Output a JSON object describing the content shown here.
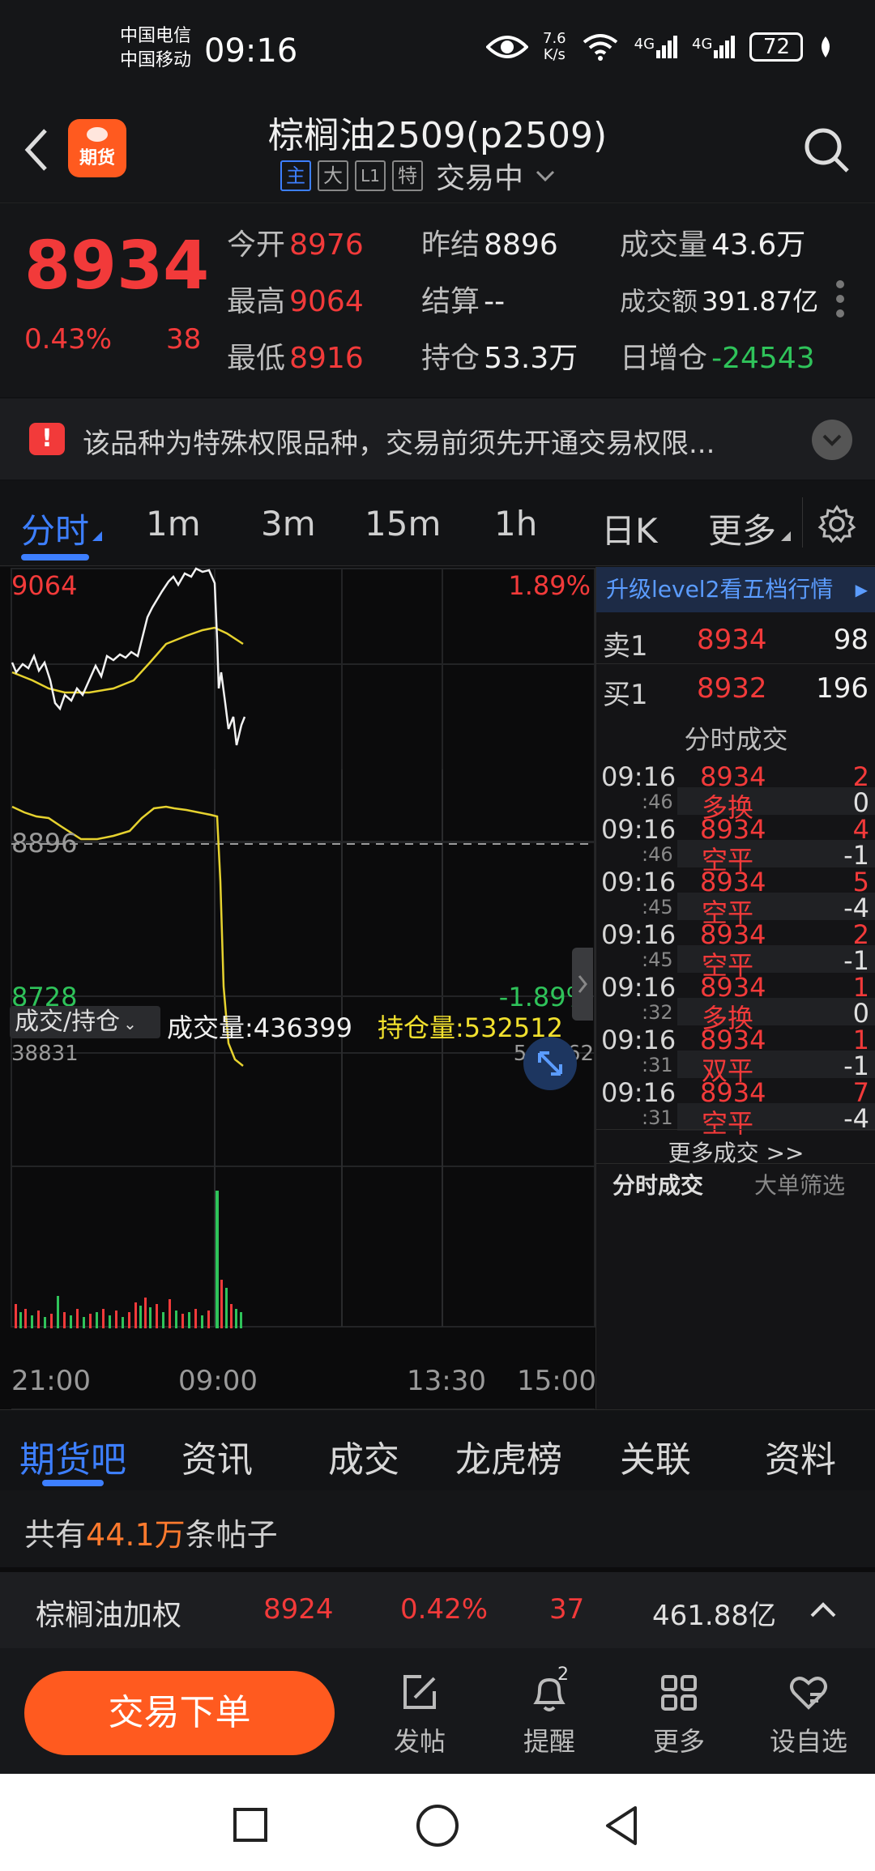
{
  "status": {
    "carrier1": "中国电信",
    "carrier2": "中国移动",
    "time": "09:16",
    "net_speed_top": "7.6",
    "net_speed_bottom": "K/s",
    "signal1": "4G",
    "signal2": "4G",
    "battery": "72"
  },
  "header": {
    "logo_text": "期货",
    "title": "棕榈油2509(p2509)",
    "tags": [
      "主",
      "大",
      "L1",
      "特"
    ],
    "state": "交易中"
  },
  "quote": {
    "price": "8934",
    "pct": "0.43%",
    "change": "38",
    "open_label": "今开",
    "open": "8976",
    "prev_settle_label": "昨结",
    "prev_settle": "8896",
    "volume_label": "成交量",
    "volume": "43.6万",
    "high_label": "最高",
    "high": "9064",
    "settle_label": "结算",
    "settle": "--",
    "turnover_label": "成交额",
    "turnover": "391.87亿",
    "low_label": "最低",
    "low": "8916",
    "oi_label": "持仓",
    "oi": "53.3万",
    "oi_change_label": "日增仓",
    "oi_change": "-24543"
  },
  "notice": {
    "text": "该品种为特殊权限品种，交易前须先开通交易权限..."
  },
  "period_tabs": [
    "分时",
    "1m",
    "3m",
    "15m",
    "1h",
    "日K",
    "更多"
  ],
  "chart": {
    "y_top": "9064",
    "y_mid": "8896",
    "y_bottom": "8728",
    "pct_top": "1.89%",
    "pct_bottom": "-1.89%",
    "sub_selector": "成交/持仓",
    "vol_label": "成交量:436399",
    "oi_label": "持仓量:532512",
    "sub_left": "38831",
    "sub_right": "560462",
    "x_labels": [
      "21:00",
      "09:00",
      "13:30",
      "15:00"
    ]
  },
  "side": {
    "upgrade": "升级level2看五档行情",
    "ask_label": "卖1",
    "ask_price": "8934",
    "ask_vol": "98",
    "bid_label": "买1",
    "bid_price": "8932",
    "bid_vol": "196",
    "ticks_title": "分时成交",
    "ticks": [
      {
        "t": "09:16",
        "s": ":46",
        "p": "8934",
        "v": "2",
        "type": "多换",
        "d": "0"
      },
      {
        "t": "09:16",
        "s": ":46",
        "p": "8934",
        "v": "4",
        "type": "空平",
        "d": "-1"
      },
      {
        "t": "09:16",
        "s": ":45",
        "p": "8934",
        "v": "5",
        "type": "空平",
        "d": "-4"
      },
      {
        "t": "09:16",
        "s": ":45",
        "p": "8934",
        "v": "2",
        "type": "空平",
        "d": "-1"
      },
      {
        "t": "09:16",
        "s": ":32",
        "p": "8934",
        "v": "1",
        "type": "多换",
        "d": "0"
      },
      {
        "t": "09:16",
        "s": ":31",
        "p": "8934",
        "v": "1",
        "type": "双平",
        "d": "-1"
      },
      {
        "t": "09:16",
        "s": ":31",
        "p": "8934",
        "v": "7",
        "type": "空平",
        "d": "-4"
      }
    ],
    "more": "更多成交 >>",
    "tab1": "分时成交",
    "tab2": "大单筛选"
  },
  "content_tabs": [
    "期货吧",
    "资讯",
    "成交",
    "龙虎榜",
    "关联",
    "资料"
  ],
  "posts": {
    "prefix": "共有",
    "count": "44.1万",
    "suffix": "条帖子"
  },
  "index_bar": {
    "name": "棕榈油加权",
    "price": "8924",
    "pct": "0.42%",
    "change": "37",
    "turnover": "461.88亿"
  },
  "actions": {
    "trade": "交易下单",
    "post": "发帖",
    "remind": "提醒",
    "remind_badge": "2",
    "more": "更多",
    "watch": "设自选"
  },
  "colors": {
    "up": "#f23a3a",
    "down": "#2fc35a",
    "accent": "#3d7fff",
    "brand": "#ff5a1f"
  }
}
